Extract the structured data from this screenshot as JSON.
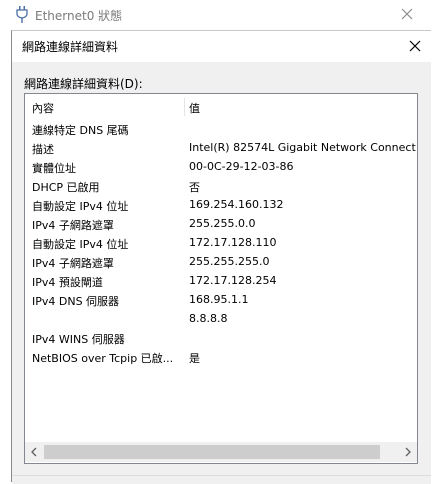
{
  "parent_window": {
    "title": "Ethernet0 狀態"
  },
  "dialog": {
    "title": "網路連線詳細資料",
    "group_label": "網路連線詳細資料(D):",
    "columns": [
      "內容",
      "值"
    ],
    "rows": [
      {
        "property": "連線特定 DNS 尾碼",
        "value": ""
      },
      {
        "property": "描述",
        "value": "Intel(R) 82574L Gigabit Network Connect"
      },
      {
        "property": "實體位址",
        "value": "00-0C-29-12-03-86"
      },
      {
        "property": "DHCP 已啟用",
        "value": "否"
      },
      {
        "property": "自動設定 IPv4 位址",
        "value": "169.254.160.132"
      },
      {
        "property": "IPv4 子網路遮罩",
        "value": "255.255.0.0"
      },
      {
        "property": "自動設定 IPv4 位址",
        "value": "172.17.128.110"
      },
      {
        "property": "IPv4 子網路遮罩",
        "value": "255.255.255.0"
      },
      {
        "property": "IPv4 預設閘道",
        "value": "172.17.128.254"
      },
      {
        "property": "IPv4 DNS 伺服器",
        "value": "168.95.1.1"
      },
      {
        "property": "",
        "value": "8.8.8.8"
      },
      {
        "property": "IPv4 WINS 伺服器",
        "value": ""
      },
      {
        "property": "NetBIOS over Tcpip 已啟...",
        "value": "是"
      }
    ]
  },
  "icons": {
    "parent_icon": "plug-icon",
    "close": "close-icon",
    "scroll_left": "chevron-left-icon",
    "scroll_right": "chevron-right-icon"
  }
}
